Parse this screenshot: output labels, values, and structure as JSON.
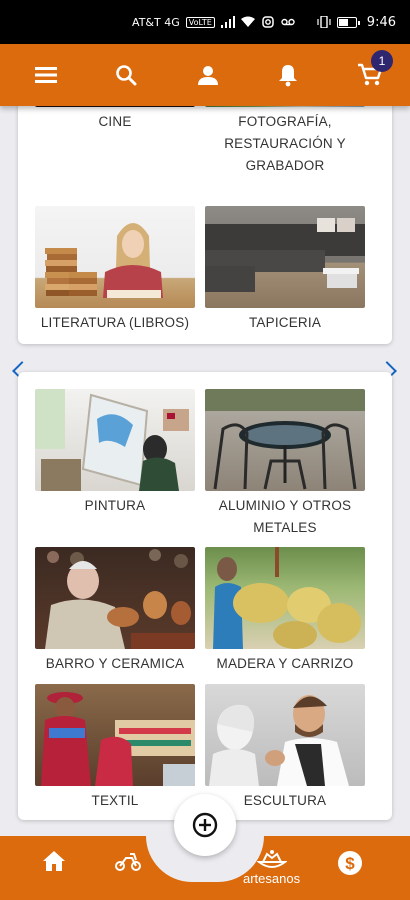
{
  "status_bar": {
    "carrier": "AT&T 4G",
    "network_badge": "VoLTE",
    "time": "9:46",
    "battery_level": 0.5
  },
  "header": {
    "icons": [
      "menu-icon",
      "search-icon",
      "account-icon",
      "notifications-icon",
      "cart-icon"
    ],
    "cart_count": "1",
    "bar_color": "#dc6b0e",
    "badge_color": "#2e2770"
  },
  "card1": {
    "tiles": [
      {
        "label": "CINE"
      },
      {
        "label": "FOTOGRAFÍA, RESTAURACIÓN Y GRABADOR"
      },
      {
        "label": "LITERATURA (LIBROS)"
      },
      {
        "label": "TAPICERIA"
      }
    ]
  },
  "card2": {
    "tiles": [
      {
        "label": "PINTURA"
      },
      {
        "label": "ALUMINIO Y OTROS METALES"
      },
      {
        "label": "BARRO Y CERAMICA"
      },
      {
        "label": "MADERA Y CARRIZO"
      },
      {
        "label": "TEXTIL"
      },
      {
        "label": "ESCULTURA"
      }
    ]
  },
  "bottom_nav": {
    "items": [
      {
        "icon": "home-icon"
      },
      {
        "icon": "scooter-icon"
      },
      {
        "icon": "artisans-icon",
        "label": "artesanos"
      },
      {
        "icon": "money-icon"
      }
    ],
    "fab_icon": "add-circle-icon"
  }
}
